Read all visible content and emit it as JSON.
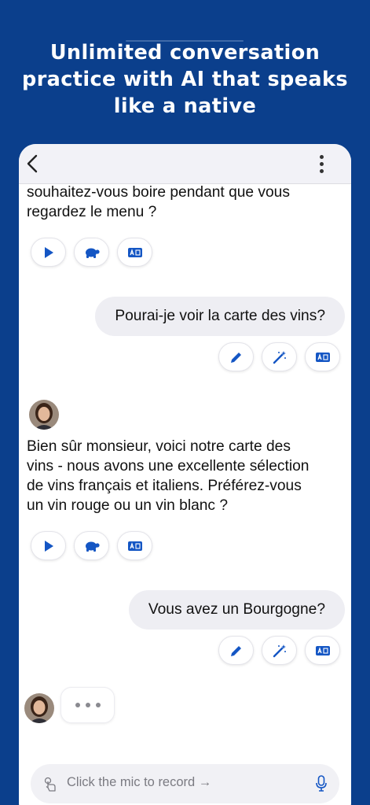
{
  "headline": {
    "line1": "Unlimited conversation",
    "line2": "practice with AI that speaks",
    "line3": "like a native"
  },
  "chat": {
    "ai_message_1_partial": [
      "souhaitez-vous boire pendant que vous",
      "regardez le menu ?"
    ],
    "user_message_1": "Pourai-je voir la carte des vins?",
    "ai_message_2": [
      "Bien sûr monsieur, voici notre carte des",
      "vins - nous avons une excellente sélection",
      "de vins français et italiens. Préférez-vous",
      "un vin rouge ou un vin blanc ?"
    ],
    "user_message_2": "Vous avez un Bourgogne?"
  },
  "input": {
    "placeholder": "Click the mic to record →"
  },
  "icons": {
    "back": "chevron-left-icon",
    "more": "more-vertical-icon",
    "play": "play-icon",
    "slow": "turtle-icon",
    "translate": "translate-icon",
    "edit": "pencil-icon",
    "improve": "magic-wand-icon",
    "record": "hand-tap-icon",
    "mic": "microphone-icon"
  },
  "colors": {
    "background": "#0b3f8c",
    "accent": "#1456c4",
    "bubble": "#eeeef3"
  }
}
